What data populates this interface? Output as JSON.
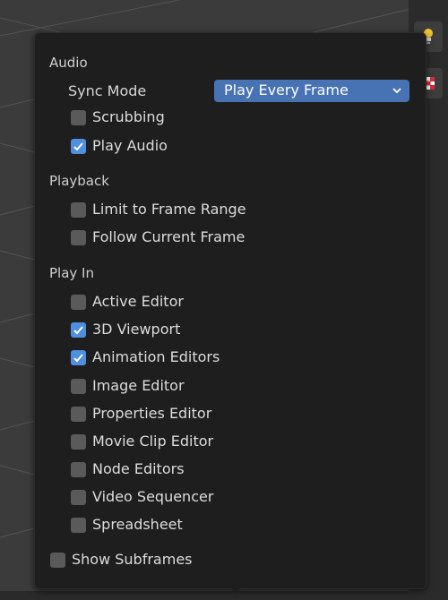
{
  "popover": {
    "audio": {
      "section_label": "Audio",
      "sync_mode_label": "Sync Mode",
      "sync_mode_value": "Play Every Frame",
      "scrubbing": {
        "label": "Scrubbing",
        "checked": false
      },
      "play_audio": {
        "label": "Play Audio",
        "checked": true
      }
    },
    "playback": {
      "section_label": "Playback",
      "limit_to_frame_range": {
        "label": "Limit to Frame Range",
        "checked": false
      },
      "follow_current_frame": {
        "label": "Follow Current Frame",
        "checked": false
      }
    },
    "play_in": {
      "section_label": "Play In",
      "items": [
        {
          "label": "Active Editor",
          "checked": false
        },
        {
          "label": "3D Viewport",
          "checked": true
        },
        {
          "label": "Animation Editors",
          "checked": true
        },
        {
          "label": "Image Editor",
          "checked": false
        },
        {
          "label": "Properties Editor",
          "checked": false
        },
        {
          "label": "Movie Clip Editor",
          "checked": false
        },
        {
          "label": "Node Editors",
          "checked": false
        },
        {
          "label": "Video Sequencer",
          "checked": false
        },
        {
          "label": "Spreadsheet",
          "checked": false
        }
      ]
    },
    "show_subframes": {
      "label": "Show Subframes",
      "checked": false
    }
  },
  "toolbar": {
    "icons": [
      "lightbulb-icon",
      "checker-icon"
    ]
  },
  "colors": {
    "accent": "#4772b3",
    "checkbox_on": "#4e8fe0",
    "checkbox_off": "#5a5a5a",
    "panel_bg": "#1e1e1e"
  }
}
